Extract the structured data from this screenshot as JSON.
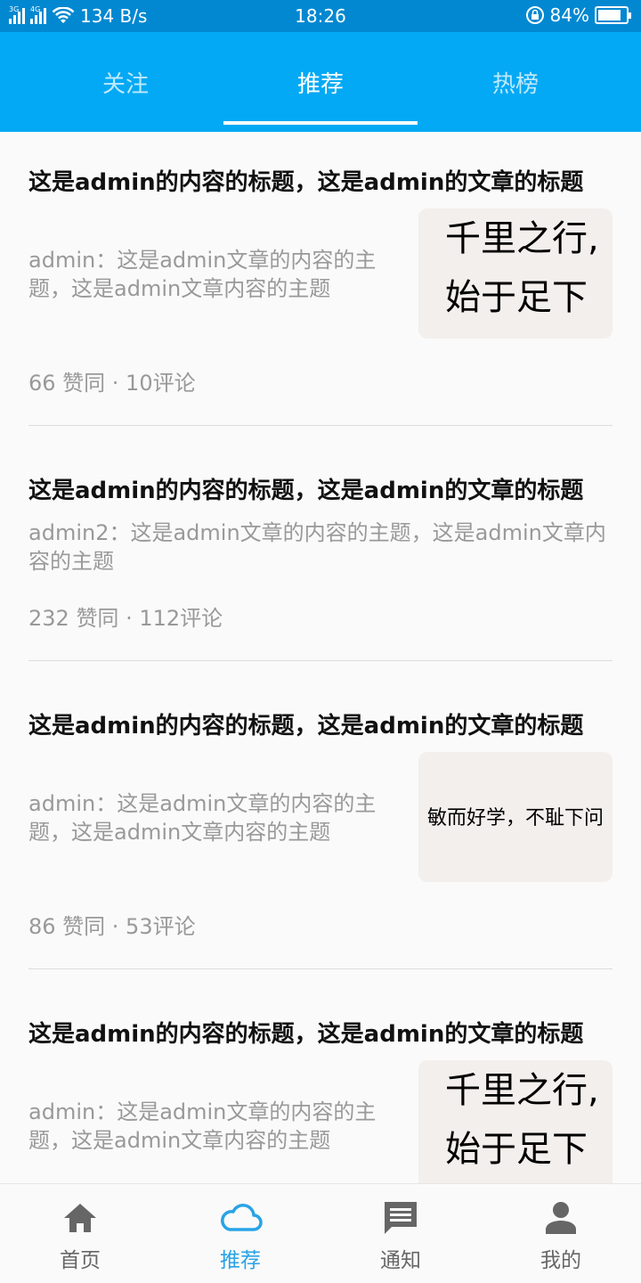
{
  "status_bar": {
    "network_3g": "3G",
    "network_4g": "4G",
    "speed": "134 B/s",
    "time": "18:26",
    "battery": "84%",
    "battery_level": 0.84
  },
  "top_tabs": [
    {
      "label": "关注",
      "active": false
    },
    {
      "label": "推荐",
      "active": true
    },
    {
      "label": "热榜",
      "active": false
    }
  ],
  "feed": [
    {
      "title": "这是admin的内容的标题，这是admin的文章的标题",
      "summary_line1": "admin：这是admin文章的内容的主",
      "summary_line2": "题，这是admin文章内容的主题",
      "thumb_line1": "千里之行,",
      "thumb_line2": "始于足下",
      "meta": "66 赞同 · 10评论"
    },
    {
      "title": "这是admin的内容的标题，这是admin的文章的标题",
      "summary_line1": "admin2：这是admin文章的内容的主题，这是admin文章内",
      "summary_line2": "容的主题",
      "meta": "232 赞同 · 112评论"
    },
    {
      "title": "这是admin的内容的标题，这是admin的文章的标题",
      "summary_line1": "admin：这是admin文章的内容的主",
      "summary_line2": "题，这是admin文章内容的主题",
      "thumb_text": "敏而好学，不耻下问",
      "meta": "86 赞同 · 53评论"
    },
    {
      "title": "这是admin的内容的标题，这是admin的文章的标题",
      "summary_line1": "admin：这是admin文章的内容的主",
      "summary_line2": "题，这是admin文章内容的主题",
      "thumb_line1": "千里之行,",
      "thumb_line2": "始于足下"
    }
  ],
  "bottom_nav": [
    {
      "label": "首页",
      "icon": "home-icon",
      "active": false
    },
    {
      "label": "推荐",
      "icon": "cloud-icon",
      "active": true
    },
    {
      "label": "通知",
      "icon": "message-icon",
      "active": false
    },
    {
      "label": "我的",
      "icon": "person-icon",
      "active": false
    }
  ],
  "colors": {
    "status_bar": "#0288d1",
    "top_bar": "#03a9f4",
    "active_nav": "#29a3e6",
    "thumb_bg": "#f3efed"
  }
}
